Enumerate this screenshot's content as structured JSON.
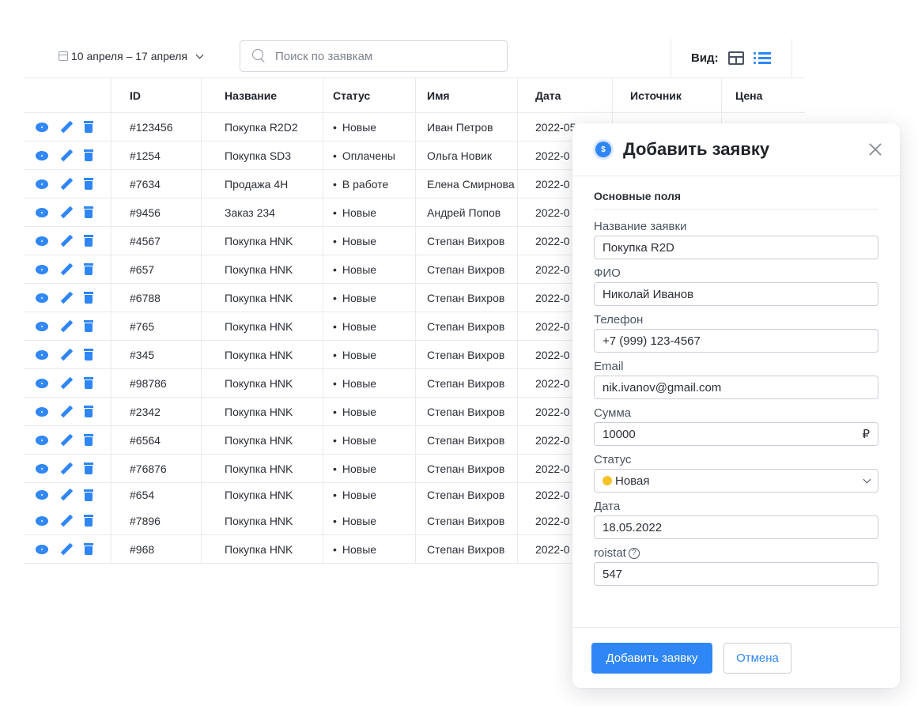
{
  "toolbar": {
    "date_range": "10 апреля – 17 апреля",
    "search_placeholder": "Поиск по заявкам",
    "view_label": "Вид:"
  },
  "table": {
    "columns": [
      "ID",
      "Название",
      "Статус",
      "Имя",
      "Дата",
      "Источник",
      "Цена"
    ],
    "rows": [
      {
        "id": "#123456",
        "name": "Покупка R2D2",
        "status": "Новые",
        "person": "Иван Петров",
        "date": "2022-05",
        "source": "",
        "price": ""
      },
      {
        "id": "#1254",
        "name": "Покупка SD3",
        "status": "Оплачены",
        "person": "Ольга Новик",
        "date": "2022-0",
        "source": "",
        "price": ""
      },
      {
        "id": "#7634",
        "name": "Продажа 4H",
        "status": "В работе",
        "person": "Елена Смирнова",
        "date": "2022-0",
        "source": "",
        "price": ""
      },
      {
        "id": "#9456",
        "name": "Заказ 234",
        "status": "Новые",
        "person": "Андрей Попов",
        "date": "2022-0",
        "source": "",
        "price": ""
      },
      {
        "id": "#4567",
        "name": "Покупка HNK",
        "status": "Новые",
        "person": "Степан Вихров",
        "date": "2022-0",
        "source": "",
        "price": ""
      },
      {
        "id": "#657",
        "name": "Покупка HNK",
        "status": "Новые",
        "person": "Степан Вихров",
        "date": "2022-0",
        "source": "",
        "price": ""
      },
      {
        "id": "#6788",
        "name": "Покупка HNK",
        "status": "Новые",
        "person": "Степан Вихров",
        "date": "2022-0",
        "source": "",
        "price": ""
      },
      {
        "id": "#765",
        "name": "Покупка HNK",
        "status": "Новые",
        "person": "Степан Вихров",
        "date": "2022-0",
        "source": "",
        "price": ""
      },
      {
        "id": "#345",
        "name": "Покупка HNK",
        "status": "Новые",
        "person": "Степан Вихров",
        "date": "2022-0",
        "source": "",
        "price": ""
      },
      {
        "id": "#98786",
        "name": "Покупка HNK",
        "status": "Новые",
        "person": "Степан Вихров",
        "date": "2022-0",
        "source": "",
        "price": ""
      },
      {
        "id": "#2342",
        "name": "Покупка HNK",
        "status": "Новые",
        "person": "Степан Вихров",
        "date": "2022-0",
        "source": "",
        "price": ""
      },
      {
        "id": "#6564",
        "name": "Покупка HNK",
        "status": "Новые",
        "person": "Степан Вихров",
        "date": "2022-0",
        "source": "",
        "price": ""
      },
      {
        "id": "#76876",
        "name": "Покупка HNK",
        "status": "Новые",
        "person": "Степан Вихров",
        "date": "2022-0",
        "source": "",
        "price": ""
      },
      {
        "id": "#654",
        "name": "Покупка HNK",
        "status": "Новые",
        "person": "Степан Вихров",
        "date": "2022-0",
        "source": "",
        "price": ""
      },
      {
        "id": "#7896",
        "name": "Покупка HNK",
        "status": "Новые",
        "person": "Степан Вихров",
        "date": "2022-0",
        "source": "",
        "price": ""
      },
      {
        "id": "#968",
        "name": "Покупка HNK",
        "status": "Новые",
        "person": "Степан Вихров",
        "date": "2022-0",
        "source": "",
        "price": ""
      }
    ]
  },
  "modal": {
    "title": "Добавить заявку",
    "coin_icon": "$",
    "section_title": "Основные поля",
    "fields": {
      "name": {
        "label": "Название заявки",
        "value": "Покупка R2D"
      },
      "fio": {
        "label": "ФИО",
        "value": "Николай Иванов"
      },
      "phone": {
        "label": "Телефон",
        "value": "+7 (999) 123-4567"
      },
      "email": {
        "label": "Email",
        "value": "nik.ivanov@gmail.com"
      },
      "sum": {
        "label": "Сумма",
        "value": "10000",
        "currency": "₽"
      },
      "status": {
        "label": "Статус",
        "value": "Новая",
        "dot_color": "#f5c228"
      },
      "date": {
        "label": "Дата",
        "value": "18.05.2022"
      },
      "roistat": {
        "label": "roistat",
        "value": "547",
        "help_icon": "?"
      }
    },
    "submit_label": "Добавить заявку",
    "cancel_label": "Отмена"
  },
  "colors": {
    "accent": "#2f86f6",
    "status_new": "#f5c228"
  }
}
